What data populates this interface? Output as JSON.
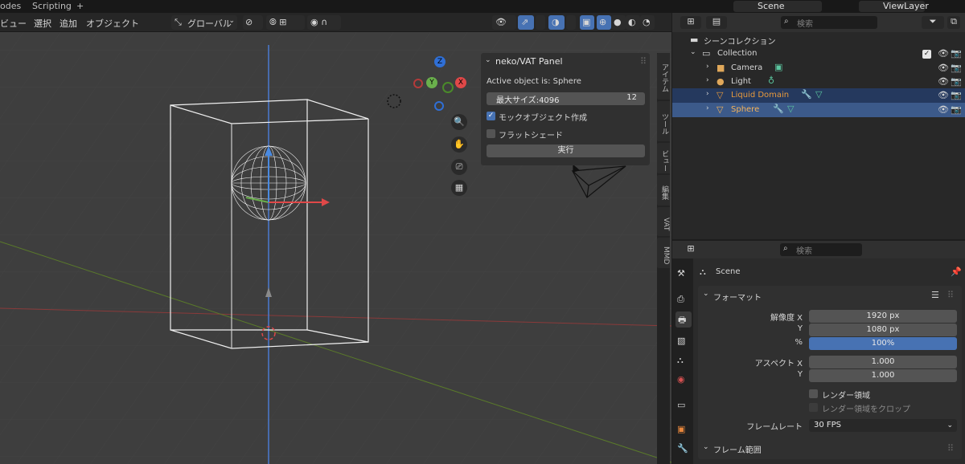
{
  "topbar": {
    "modes": "odes",
    "scripting": "Scripting",
    "plus": "+",
    "scene": "Scene",
    "viewlayer": "ViewLayer"
  },
  "viewport_header": {
    "menus": [
      "ビュー",
      "選択",
      "追加",
      "オブジェクト"
    ],
    "transform_orientation": "グローバル"
  },
  "npanel": {
    "title": "neko/VAT Panel",
    "active_label": "Active object is: Sphere",
    "max_size_label": "最大サイズ:4096",
    "max_size_value": "12",
    "mock_label": "モックオブジェクト作成",
    "mock_checked": true,
    "flat_label": "フラットシェード",
    "flat_checked": false,
    "run_label": "実行"
  },
  "side_tabs": [
    "アイテム",
    "ツール",
    "ビュー",
    "編集",
    "VAT",
    "MMD"
  ],
  "gizmo": {
    "z": "Z",
    "y": "Y",
    "x": "X"
  },
  "outliner": {
    "search_placeholder": "検索",
    "root": "シーンコレクション",
    "items": [
      {
        "name": "Collection",
        "indent": 0,
        "type": "collection"
      },
      {
        "name": "Camera",
        "indent": 1,
        "type": "camera"
      },
      {
        "name": "Light",
        "indent": 1,
        "type": "light"
      },
      {
        "name": "Liquid Domain",
        "indent": 1,
        "type": "mesh",
        "selected": "dim"
      },
      {
        "name": "Sphere",
        "indent": 1,
        "type": "mesh",
        "selected": "active"
      }
    ]
  },
  "properties": {
    "search_placeholder": "検索",
    "context": "Scene",
    "format_panel": "フォーマット",
    "res_x_label": "解像度 X",
    "res_x": "1920 px",
    "res_y_label": "Y",
    "res_y": "1080 px",
    "pct_label": "%",
    "pct": "100%",
    "aspect_x_label": "アスペクト X",
    "aspect_x": "1.000",
    "aspect_y_label": "Y",
    "aspect_y": "1.000",
    "render_region": "レンダー領域",
    "crop_region": "レンダー領域をクロップ",
    "framerate_label": "フレームレート",
    "framerate": "30 FPS",
    "frame_range_panel": "フレーム範囲"
  }
}
